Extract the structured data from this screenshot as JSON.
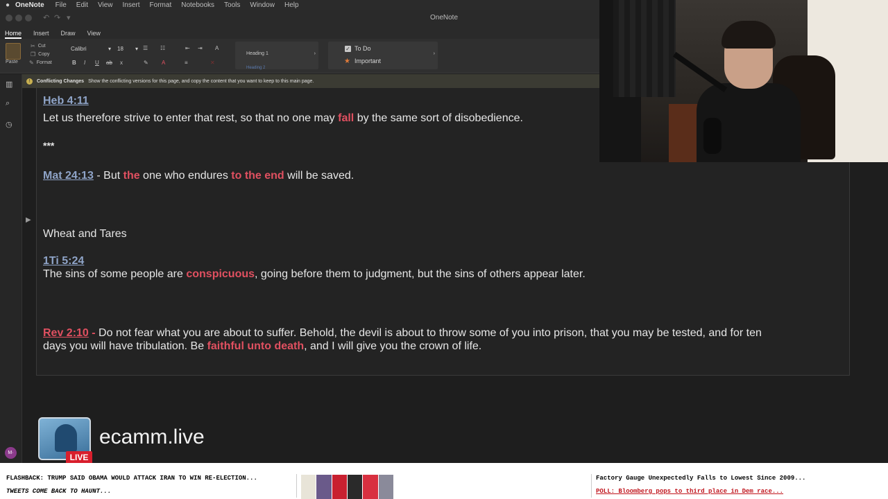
{
  "menubar": {
    "app_name": "OneNote",
    "items": [
      "File",
      "Edit",
      "View",
      "Insert",
      "Format",
      "Notebooks",
      "Tools",
      "Window",
      "Help"
    ]
  },
  "window": {
    "title": "OneNote"
  },
  "ribbon": {
    "tabs": [
      "Home",
      "Insert",
      "Draw",
      "View"
    ],
    "active_tab": "Home",
    "paste_label": "Paste",
    "clipboard": [
      "Cut",
      "Copy",
      "Format"
    ],
    "font_name": "Calibri",
    "font_size": "18",
    "format_buttons": [
      "B",
      "I",
      "U",
      "ab",
      "x"
    ],
    "styles": {
      "heading1": "Heading 1",
      "heading2": "Heading 2"
    },
    "tags": {
      "todo": "To Do",
      "important": "Important"
    }
  },
  "infobar": {
    "title": "Conflicting Changes",
    "message": "Show the conflicting versions for this page, and copy the content that you want to keep to this main page."
  },
  "note": {
    "heb_ref": "Heb 4:11",
    "heb_text_1": "Let us therefore strive to enter that rest, so that no one may ",
    "heb_hl": "fall",
    "heb_text_2": " by the same sort of disobedience.",
    "separator": "***",
    "mat_ref": "Mat 24:13",
    "mat_text_1": " - But ",
    "mat_hl_1": "the",
    "mat_text_2": " one who endures ",
    "mat_hl_2": "to the end",
    "mat_text_3": " will be saved.",
    "heading": "Wheat and Tares",
    "tim_ref": "1Ti 5:24",
    "tim_text_1": "The sins of some people are ",
    "tim_hl": "conspicuous",
    "tim_text_2": ", going before them to judgment, but the sins of others appear later.",
    "rev_ref": "Rev 2:10",
    "rev_dash": " -",
    "rev_text_1": " Do not fear what you are about to suffer. Behold, the devil is about to throw some of you into prison, that you may be tested, and for ten",
    "rev_text_2": "days you will have tribulation. Be ",
    "rev_hl": "faithful unto death",
    "rev_text_3": ", and I will give you the crown of life."
  },
  "overlay": {
    "brand": "ecamm.live",
    "live_badge": "LIVE"
  },
  "user": {
    "avatar": "M·"
  },
  "ticker": {
    "left_1": "FLASHBACK: TRUMP SAID OBAMA WOULD ATTACK IRAN TO WIN RE-ELECTION...",
    "left_2": "TWEETS COME BACK TO HAUNT...",
    "right_1": "Factory Gauge Unexpectedly Falls to Lowest Since 2009...",
    "right_2": "POLL: Bloomberg pops to third place in Dem race..."
  },
  "colors": {
    "highlight_red": "#e05060",
    "link_blue": "#8fa4c8",
    "live_red": "#d81e2c"
  }
}
